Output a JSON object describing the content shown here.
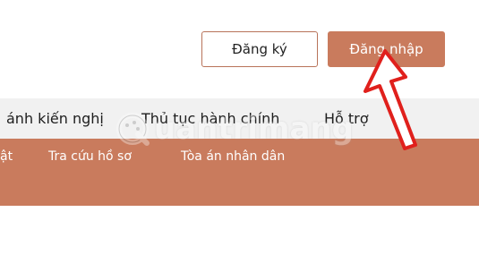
{
  "header": {
    "register_label": "Đăng ký",
    "login_label": "Đăng nhập"
  },
  "nav": {
    "items": [
      {
        "label": "ánh kiến nghị"
      },
      {
        "label": "Thủ tục hành chính"
      },
      {
        "label": "Hỗ trợ"
      }
    ]
  },
  "subnav": {
    "items": [
      {
        "label": "ật"
      },
      {
        "label": "Tra cứu hồ sơ"
      },
      {
        "label": "Tòa án nhân dân"
      }
    ]
  },
  "watermark": {
    "text": "uantrimang",
    "icon": "quantrimang-logo-icon"
  },
  "annotation": {
    "icon": "red-arrow-icon",
    "color": "#e0201c"
  },
  "colors": {
    "accent": "#c97b5d",
    "nav_background": "#f1f1f1"
  }
}
